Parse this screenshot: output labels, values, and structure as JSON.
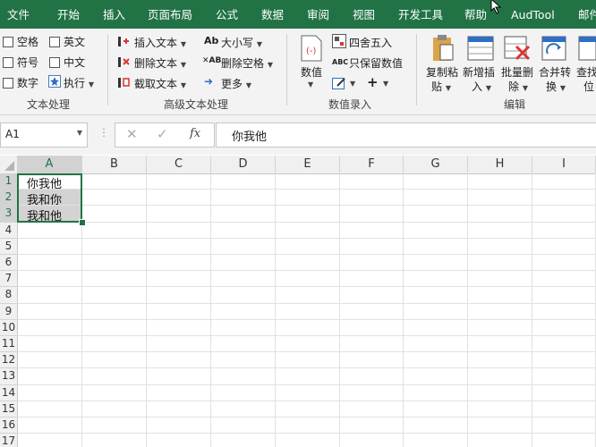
{
  "colors": {
    "accent": "#217346",
    "selection_fill": "#d3d3d3"
  },
  "tabs": [
    "文件",
    "开始",
    "插入",
    "页面布局",
    "公式",
    "数据",
    "审阅",
    "视图",
    "开发工具",
    "帮助",
    "AudTool",
    "邮件"
  ],
  "ribbon": {
    "text_group": {
      "label": "文本处理",
      "items": [
        "空格",
        "英文",
        "符号",
        "中文",
        "数字",
        "执行"
      ]
    },
    "adv_group": {
      "label": "高级文本处理",
      "insert_text": "插入文本",
      "delete_text": "删除文本",
      "extract_text": "截取文本",
      "case": "大小写",
      "delete_space": "删除空格",
      "more": "更多"
    },
    "num_group": {
      "label": "数值录入",
      "number": "数值",
      "round": "四舍五入",
      "keep_value": "只保留数值"
    },
    "edit_group": {
      "label": "编辑",
      "copy_paste": [
        "复制粘",
        "贴"
      ],
      "new_insert": [
        "新增插",
        "入"
      ],
      "batch_delete": [
        "批量删",
        "除"
      ],
      "merge_convert": [
        "合并转",
        "换"
      ],
      "find_locate": [
        "查找",
        "位"
      ]
    }
  },
  "formula_bar": {
    "name_box": "A1",
    "fx_label": "fx",
    "value": "你我他"
  },
  "sheet": {
    "columns": [
      "A",
      "B",
      "C",
      "D",
      "E",
      "F",
      "G",
      "H",
      "I"
    ],
    "rows": [
      "1",
      "2",
      "3",
      "4",
      "5",
      "6",
      "7",
      "8",
      "9",
      "10",
      "11",
      "12",
      "13",
      "14",
      "15",
      "16",
      "17"
    ],
    "cells": [
      "你我他",
      "我和你",
      "我和他"
    ]
  }
}
